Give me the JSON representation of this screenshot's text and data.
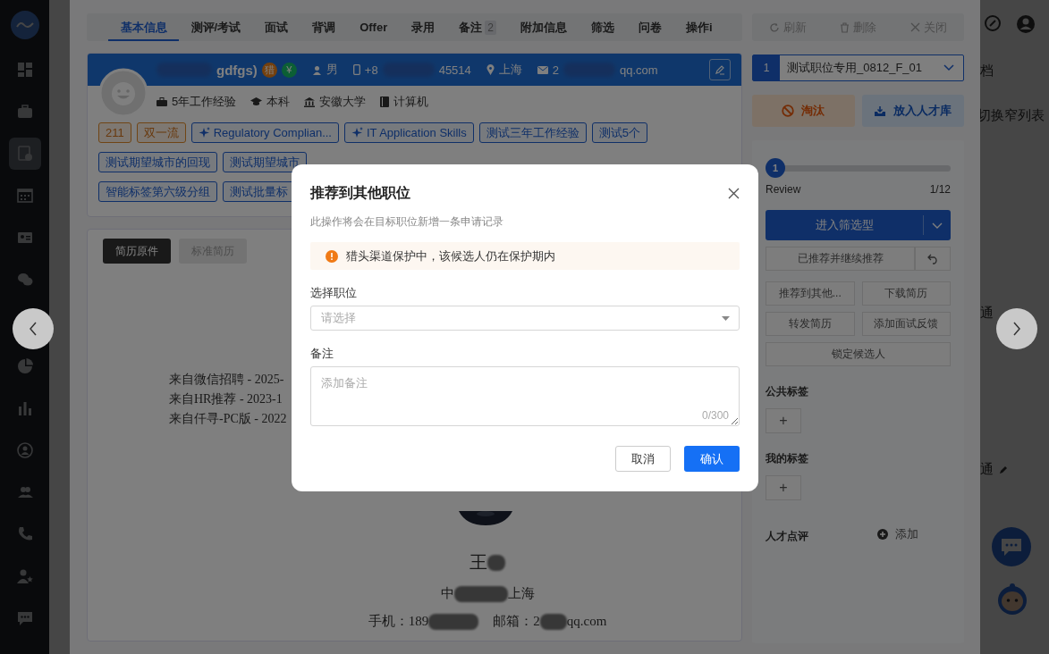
{
  "sidebar": {
    "items": [
      {
        "selected": false
      },
      {
        "selected": false
      },
      {
        "selected": true
      },
      {
        "selected": false
      },
      {
        "selected": false
      },
      {
        "selected": false
      },
      {
        "selected": false
      },
      {
        "selected": false
      },
      {
        "selected": false
      },
      {
        "selected": false
      },
      {
        "selected": false
      },
      {
        "selected": false
      },
      {
        "selected": false
      }
    ]
  },
  "background": {
    "texts": [
      "档",
      "切换窄列表",
      "通",
      "通"
    ]
  },
  "tabs": [
    {
      "label": "基本信息",
      "selected": true
    },
    {
      "label": "测评/考试",
      "selected": false
    },
    {
      "label": "面试",
      "selected": false
    },
    {
      "label": "背调",
      "selected": false
    },
    {
      "label": "Offer",
      "selected": false
    },
    {
      "label": "录用",
      "selected": false
    },
    {
      "label": "备注",
      "selected": false,
      "badge": "2"
    },
    {
      "label": "附加信息",
      "selected": false
    },
    {
      "label": "筛选",
      "selected": false
    },
    {
      "label": "问卷",
      "selected": false
    },
    {
      "label": "操作i",
      "selected": false
    }
  ],
  "candidate": {
    "name": "gdfgs)",
    "badges": [
      {
        "label": "猎",
        "kind": "orange"
      },
      {
        "label": "¥",
        "kind": "green"
      }
    ],
    "gender": "男",
    "phone_start": "+8",
    "phone_end": "45514",
    "city": "上海",
    "email_start": "2",
    "email_end": "qq.com",
    "facts": [
      {
        "kind": "work",
        "label": "5年工作经验"
      },
      {
        "kind": "degree",
        "label": "本科"
      },
      {
        "kind": "school",
        "label": "安徽大学"
      },
      {
        "kind": "major",
        "label": "计算机"
      }
    ],
    "tag_rows": [
      [
        {
          "kind": "school",
          "label": "211"
        },
        {
          "kind": "school",
          "label": "双一流"
        },
        {
          "kind": "ai",
          "label": "Regulatory Complian..."
        },
        {
          "kind": "ai",
          "label": "IT Application Skills"
        },
        {
          "kind": "plain",
          "label": "测试三年工作经验"
        },
        {
          "kind": "plain",
          "label": "测试5个"
        }
      ],
      [
        {
          "kind": "plain",
          "label": "测试期望城市的回现"
        },
        {
          "kind": "plain",
          "label": "测试期望城市"
        }
      ],
      [
        {
          "kind": "plain",
          "label": "智能标签第六级分组"
        },
        {
          "kind": "plain",
          "label": "测试批量标"
        }
      ]
    ]
  },
  "resume": {
    "views": [
      {
        "label": "简历原件",
        "selected": true
      },
      {
        "label": "标准简历",
        "selected": false
      }
    ],
    "sources": [
      "来自微信招聘 - 2025-",
      "来自HR推荐 - 2023-1",
      "来自仟寻-PC版 - 2022"
    ],
    "name": "王",
    "location_start": "中",
    "location_end": "上海",
    "phone": "手机：189",
    "email_label": "邮箱：2",
    "email_end": "qq.com"
  },
  "toolbar": [
    {
      "kind": "refresh",
      "label": "刷新"
    },
    {
      "kind": "delete",
      "label": "删除"
    },
    {
      "kind": "close",
      "label": "关闭"
    }
  ],
  "job": {
    "index": "1",
    "title": "测试职位专用_0812_F_01"
  },
  "reject": "淘汰",
  "talent_pool": "放入人才库",
  "stage": {
    "step": "1",
    "level": 0,
    "name": "Review",
    "count": "1/12"
  },
  "primary": "进入筛选型",
  "recommended": "已推荐并继续推荐",
  "actions": [
    "推荐到其他...",
    "下载简历",
    "转发简历",
    "添加面试反馈",
    "锁定候选人"
  ],
  "public_tags": "公共标签",
  "public_tags_add": "+",
  "my_tags": "我的标签",
  "my_tags_add": "+",
  "review": {
    "label": "人才点评",
    "action": "添加"
  },
  "dialog": {
    "title": "推荐到其他职位",
    "subtitle": "此操作将会在目标职位新增一条申请记录",
    "warning": "猎头渠道保护中，该候选人仍在保护期内",
    "position_label": "选择职位",
    "position_placeholder": "请选择",
    "note_label": "备注",
    "note_placeholder": "添加备注",
    "counter": "0/300",
    "cancel": "取消",
    "confirm": "确认"
  }
}
